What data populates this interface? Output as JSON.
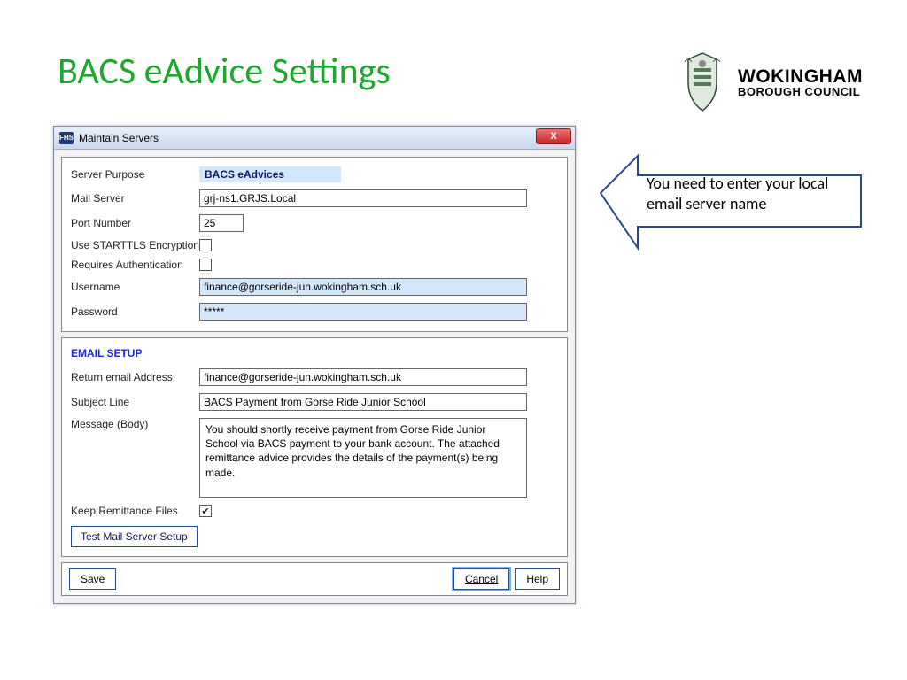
{
  "slide": {
    "title": "BACS eAdvice Settings"
  },
  "brand": {
    "main": "WOKINGHAM",
    "sub": "BOROUGH COUNCIL"
  },
  "dialog": {
    "title": "Maintain Servers",
    "app_icon_text": "FHS",
    "close_glyph": "X"
  },
  "fields": {
    "server_purpose_label": "Server Purpose",
    "server_purpose_value": "BACS eAdvices",
    "mail_server_label": "Mail Server",
    "mail_server_value": "grj-ns1.GRJS.Local",
    "port_label": "Port Number",
    "port_value": "25",
    "starttls_label": "Use STARTTLS Encryption",
    "starttls_checked": false,
    "req_auth_label": "Requires Authentication",
    "req_auth_checked": false,
    "username_label": "Username",
    "username_value": "finance@gorseride-jun.wokingham.sch.uk",
    "password_label": "Password",
    "password_value": "*****"
  },
  "email_setup": {
    "heading": "EMAIL SETUP",
    "return_label": "Return email Address",
    "return_value": "finance@gorseride-jun.wokingham.sch.uk",
    "subject_label": "Subject Line",
    "subject_value": "BACS Payment from Gorse Ride Junior School",
    "body_label": "Message (Body)",
    "body_value": "You should shortly receive payment from Gorse Ride Junior School via BACS payment to your bank account. The attached remittance advice provides the details of the payment(s) being made.",
    "keep_files_label": "Keep Remittance Files",
    "keep_files_checked": true
  },
  "buttons": {
    "test": "Test Mail Server Setup",
    "save": "Save",
    "cancel": "Cancel",
    "help": "Help"
  },
  "callout": {
    "text": "You need to enter your local email server name"
  }
}
